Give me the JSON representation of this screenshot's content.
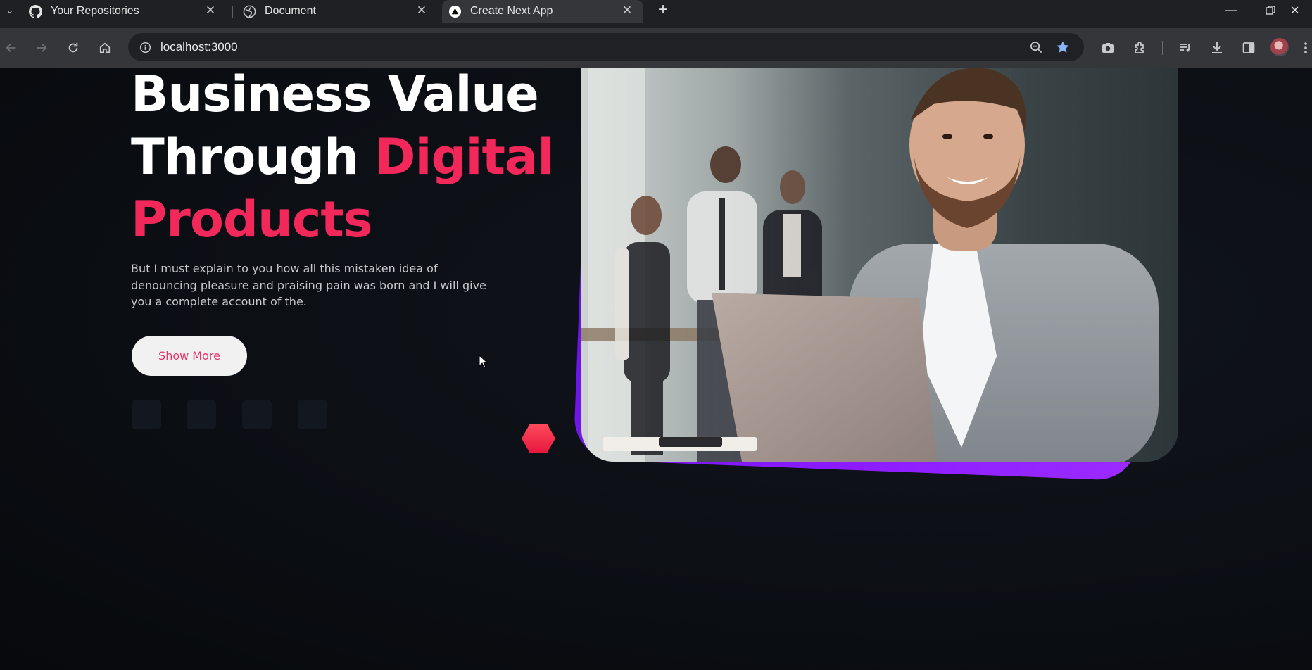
{
  "browser": {
    "tabs": [
      {
        "title": "Your Repositories",
        "icon": "github-icon",
        "active": false
      },
      {
        "title": "Document",
        "icon": "globe-icon",
        "active": false
      },
      {
        "title": "Create Next App",
        "icon": "nextjs-icon",
        "active": true
      }
    ],
    "address": "localhost:3000"
  },
  "hero": {
    "title_line1": "Business Value",
    "title_line2_plain": "Through ",
    "title_line2_accent": "Digital",
    "title_line3_accent": "Products",
    "description": "But I must explain to you how all this mistaken idea of denouncing pleasure and praising pain was born and I will give you a complete account of the.",
    "button_label": "Show More",
    "accent_color": "#f2285a",
    "frame_color": "#8a1aff"
  }
}
